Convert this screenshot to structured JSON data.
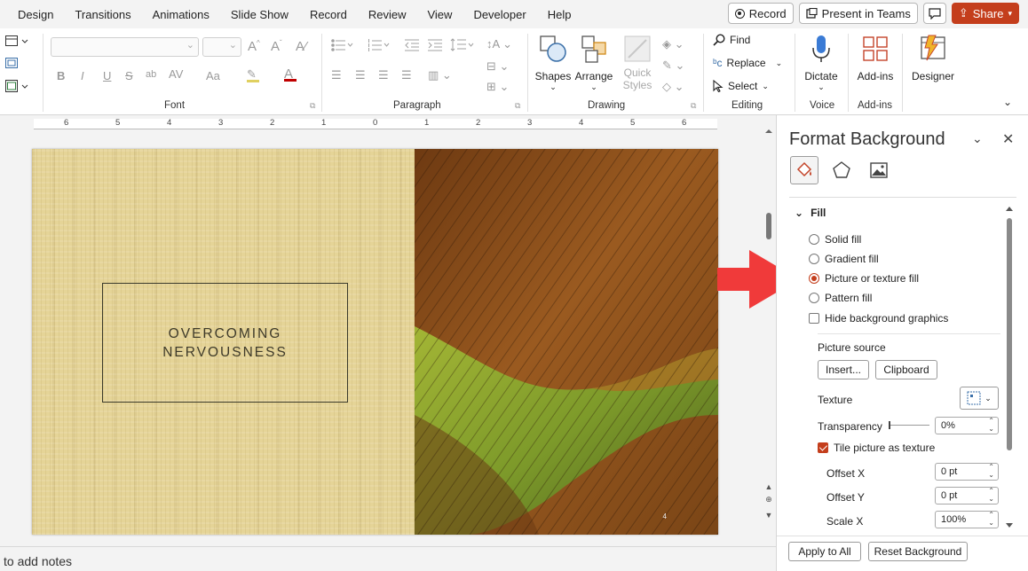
{
  "menu": {
    "items": [
      "Design",
      "Transitions",
      "Animations",
      "Slide Show",
      "Record",
      "Review",
      "View",
      "Developer",
      "Help"
    ],
    "record_label": "Record",
    "teams_label": "Present in Teams",
    "share_label": "Share"
  },
  "ribbon": {
    "groups": {
      "font": "Font",
      "paragraph": "Paragraph",
      "drawing": "Drawing",
      "editing": "Editing",
      "voice": "Voice",
      "addins": "Add-ins"
    },
    "font_buttons": [
      "B",
      "I",
      "U",
      "S",
      "ab",
      "AV",
      "Aa"
    ],
    "shapes_label": "Shapes",
    "arrange_label": "Arrange",
    "quick_styles_label": "Quick Styles",
    "find_label": "Find",
    "replace_label": "Replace",
    "select_label": "Select",
    "dictate_label": "Dictate",
    "addins_label": "Add-ins",
    "designer_label": "Designer"
  },
  "ruler": {
    "ticks": [
      "6",
      "5",
      "4",
      "3",
      "2",
      "1",
      "0",
      "1",
      "2",
      "3",
      "4",
      "5",
      "6"
    ]
  },
  "slide": {
    "title_line1": "OVERCOMING",
    "title_line2": "NERVOUSNESS",
    "number": "4"
  },
  "notes": {
    "placeholder": "to add notes"
  },
  "pane": {
    "title": "Format Background",
    "fill_section": "Fill",
    "options": {
      "solid": "Solid fill",
      "gradient": "Gradient fill",
      "picture": "Picture or texture fill",
      "pattern": "Pattern fill",
      "hide": "Hide background graphics"
    },
    "selected_option": "picture",
    "picture_source": "Picture source",
    "insert_btn": "Insert...",
    "clipboard_btn": "Clipboard",
    "texture": "Texture",
    "transparency": "Transparency",
    "transparency_value": "0%",
    "tile": "Tile picture as texture",
    "offset_x": "Offset X",
    "offset_x_value": "0 pt",
    "offset_y": "Offset Y",
    "offset_y_value": "0 pt",
    "scale_x": "Scale X",
    "scale_x_value": "100%",
    "apply_all": "Apply to All",
    "reset_bg": "Reset Background"
  },
  "colors": {
    "accent": "#c43e1c",
    "arrow": "#f03a3a"
  }
}
